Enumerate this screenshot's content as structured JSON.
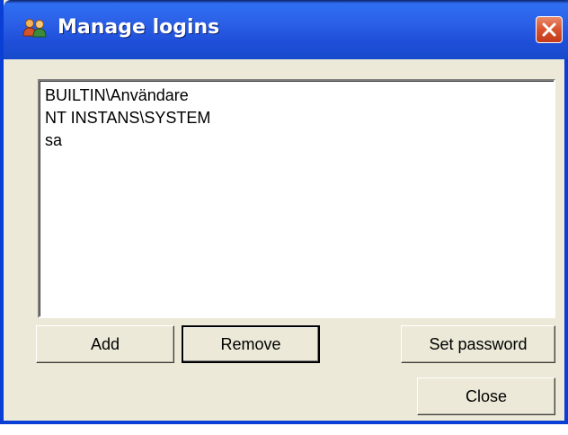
{
  "window": {
    "title": "Manage logins"
  },
  "logins": [
    "BUILTIN\\Användare",
    "NT INSTANS\\SYSTEM",
    "sa"
  ],
  "buttons": {
    "add": "Add",
    "remove": "Remove",
    "set_password": "Set password",
    "close": "Close"
  },
  "colors": {
    "titlebar": "#2a5fe6",
    "dialog_bg": "#ece9d8",
    "close_button": "#d8532f"
  },
  "icons": {
    "title": "users-icon",
    "close": "close-icon"
  }
}
